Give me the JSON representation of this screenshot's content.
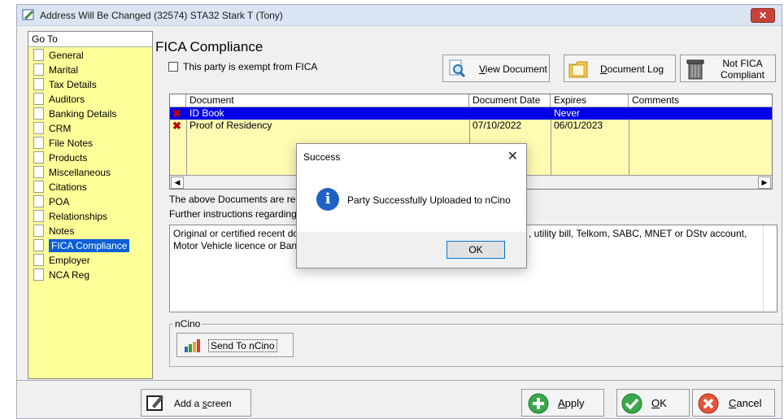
{
  "window": {
    "title": "Address Will Be Changed (32574) STA32 Stark T (Tony)",
    "close_glyph": "✕"
  },
  "goto": {
    "header": "Go To",
    "items": [
      "General",
      "Marital",
      "Tax Details",
      "Auditors",
      "Banking Details",
      "CRM",
      "File Notes",
      "Products",
      "Miscellaneous",
      "Citations",
      "POA",
      "Relationships",
      "Notes",
      "FICA Compliance",
      "Employer",
      "NCA Reg"
    ],
    "selected": "FICA Compliance"
  },
  "main": {
    "title": "FICA Compliance",
    "exempt_label": "This party is exempt from FICA",
    "view_document": {
      "prefix": "",
      "accel": "V",
      "rest": "iew Document"
    },
    "document_log": {
      "prefix": "",
      "accel": "D",
      "rest": "ocument Log"
    },
    "not_fica": {
      "line1": "Not FICA",
      "line2": "Compliant"
    }
  },
  "table": {
    "headers": [
      "Document",
      "Document Date",
      "Expires",
      "Comments"
    ],
    "rows": [
      {
        "document": "ID Book",
        "date": "",
        "expires": "Never",
        "comments": ""
      },
      {
        "document": "Proof of Residency",
        "date": "07/10/2022",
        "expires": "06/01/2023",
        "comments": ""
      }
    ]
  },
  "info": {
    "line1": "The above Documents are re",
    "line2": "Further instructions regarding",
    "instructions_left": "Original or certified recent do",
    "instructions_right": ", utility bill, Telkom, SABC, MNET or DStv account,",
    "instructions_line2": "Motor Vehicle licence or Ban"
  },
  "ncino": {
    "legend": "nCino",
    "send_label": "Send To nCino"
  },
  "bottom": {
    "add_screen": {
      "prefix": "Add a ",
      "accel": "s",
      "rest": "creen"
    },
    "apply": {
      "prefix": "",
      "accel": "A",
      "rest": "pply"
    },
    "ok": {
      "prefix": "",
      "accel": "O",
      "rest": "K"
    },
    "cancel": {
      "prefix": "",
      "accel": "C",
      "rest": "ancel"
    }
  },
  "dialog": {
    "title": "Success",
    "close_glyph": "✕",
    "icon_glyph": "i",
    "message": "Party Successfully Uploaded to nCino",
    "ok_label": "OK"
  },
  "colors": {
    "goto_bg": "#ffff99",
    "table_bg": "#fffbb3",
    "selected_row": "#0000e8",
    "selected_nav": "#0a5fd6"
  }
}
